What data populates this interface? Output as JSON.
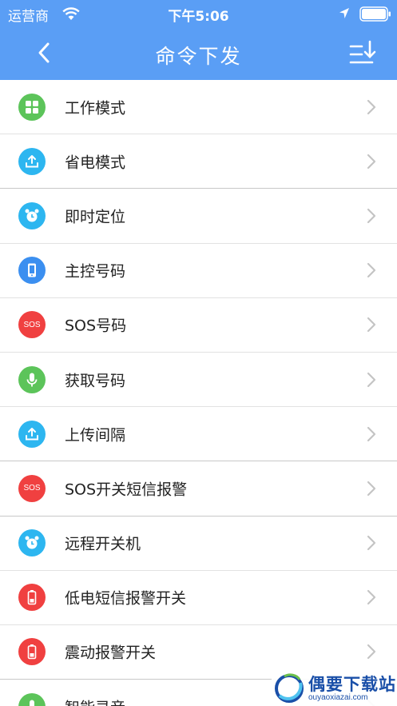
{
  "status_bar": {
    "carrier": "运营商",
    "time": "下午5:06",
    "wifi_icon": "wifi-icon",
    "location_icon": "location-arrow-icon",
    "battery_icon": "battery-icon"
  },
  "nav": {
    "title": "命令下发",
    "back_icon": "chevron-left-icon",
    "sort_icon": "sort-download-icon"
  },
  "colors": {
    "primary": "#5a9ef5",
    "green": "#5cc45a",
    "cyan": "#2db6f0",
    "blue": "#3b8ff0",
    "red": "#f04040"
  },
  "items": [
    {
      "label": "工作模式",
      "icon": "grid-apps-icon",
      "color": "#5cc45a"
    },
    {
      "label": "省电模式",
      "icon": "upload-tray-icon",
      "color": "#2db6f0"
    },
    {
      "label": "即时定位",
      "icon": "alarm-clock-icon",
      "color": "#2db6f0"
    },
    {
      "label": "主控号码",
      "icon": "mobile-phone-icon",
      "color": "#3b8ff0"
    },
    {
      "label": "SOS号码",
      "icon": "sos-icon",
      "icon_text": "SOS",
      "color": "#f04040"
    },
    {
      "label": "获取号码",
      "icon": "microphone-icon",
      "color": "#5cc45a"
    },
    {
      "label": "上传间隔",
      "icon": "upload-tray-icon",
      "color": "#2db6f0"
    },
    {
      "label": "SOS开关短信报警",
      "icon": "sos-icon",
      "icon_text": "SOS",
      "color": "#f04040"
    },
    {
      "label": "远程开关机",
      "icon": "alarm-clock-icon",
      "color": "#2db6f0"
    },
    {
      "label": "低电短信报警开关",
      "icon": "battery-low-icon",
      "color": "#f04040"
    },
    {
      "label": "震动报警开关",
      "icon": "battery-low-icon",
      "color": "#f04040"
    },
    {
      "label": "智能录音",
      "icon": "microphone-icon",
      "color": "#5cc45a"
    }
  ],
  "watermark": {
    "title": "偶要下载站",
    "subtitle": "ouyaoxiazai.com",
    "logo_icon": "site-logo-icon"
  }
}
